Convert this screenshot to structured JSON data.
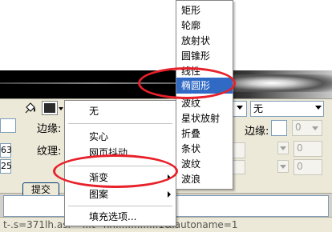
{
  "panel": {
    "edge_label": "边缘:",
    "texture_label": "纹理:",
    "left_value_1": "63",
    "left_value_2": "25",
    "fill_dropdown_value": "无",
    "right_edge_label": "边缘:",
    "spin_value": "0"
  },
  "lower": {
    "submit_label": "提交",
    "status_text": "t-.s=371lh.as.-=...t=nn..............1&lautoname=1"
  },
  "fill_menu": {
    "items": [
      "无",
      "实心",
      "网页抖动",
      "渐变",
      "图案",
      "填充选项..."
    ]
  },
  "gradient_menu": {
    "items": [
      "矩形",
      "轮廓",
      "放射状",
      "圆锥形",
      "线性",
      "椭圆形",
      "波纹",
      "星状放射",
      "折叠",
      "条状",
      "波纹",
      "波浪"
    ],
    "selected_index": 5
  },
  "colors": {
    "menu_highlight": "#316ac5",
    "annotation_red": "#e8202a"
  }
}
